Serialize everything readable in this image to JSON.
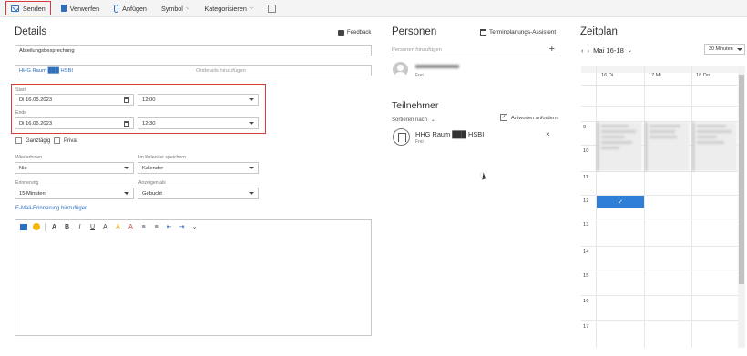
{
  "toolbar": {
    "send_label": "Senden",
    "discard_label": "Verwerfen",
    "attach_label": "Anfügen",
    "symbol_label": "Symbol",
    "categorize_label": "Kategorisieren"
  },
  "details": {
    "title": "Details",
    "feedback_label": "Feedback",
    "subject_value": "Abteilungsbesprechung",
    "location_value": "HHG Raum ███ HSBI",
    "location_details_placeholder": "Ortdetails hinzufügen",
    "start_label": "Start",
    "start_date": "Di 16.05.2023",
    "start_time": "12:00",
    "end_label": "Ende",
    "end_date": "Di 16.05.2023",
    "end_time": "12:30",
    "allday_label": "Ganztägig",
    "private_label": "Privat",
    "repeat_label": "Wiederholen",
    "repeat_value": "Nie",
    "save_calendar_label": "Im Kalender speichern",
    "save_calendar_value": "Kalender",
    "reminder_label": "Erinnerung",
    "reminder_value": "15 Minuten",
    "show_as_label": "Anzeigen als",
    "show_as_value": "Gebucht",
    "email_reminder_link": "E-Mail-Erinnerung hinzufügen"
  },
  "people": {
    "title": "Personen",
    "assistant_label": "Terminplanungs-Assistent",
    "add_placeholder": "Personen hinzufügen",
    "organizer_status": "Frei",
    "attendees_title": "Teilnehmer",
    "sort_label": "Sortieren nach",
    "request_responses_label": "Antworten anfordern",
    "room_name": "HHG Raum ███ HSBI",
    "room_status": "Frei"
  },
  "schedule": {
    "title": "Zeitplan",
    "range_label": "Mai 16-18",
    "interval_value": "30 Minuten",
    "days": [
      "16 Di",
      "17 Mi",
      "18 Do"
    ],
    "hours": [
      "9",
      "10",
      "11",
      "12",
      "13",
      "14",
      "15",
      "16",
      "17"
    ]
  },
  "icons": {
    "send": "send-icon",
    "discard": "trash-icon",
    "attach": "paperclip-icon",
    "feedback": "speech-bubble-icon",
    "calendar": "calendar-icon",
    "add": "plus-icon",
    "close": "close-icon"
  },
  "colors": {
    "accent": "#2f6fbd",
    "highlight_box": "#d73b3b",
    "selected_slot": "#2f7fd6"
  }
}
